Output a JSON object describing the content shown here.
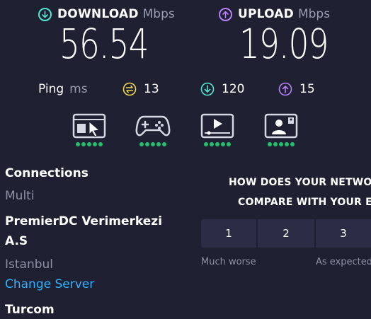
{
  "download": {
    "title": "DOWNLOAD",
    "unit": "Mbps",
    "value": "56.54",
    "icon": "arrow-down-circle",
    "color": "#4ee8d2"
  },
  "upload": {
    "title": "UPLOAD",
    "unit": "Mbps",
    "value": "19.09",
    "icon": "arrow-up-circle",
    "color": "#b682f5"
  },
  "ping": {
    "label": "Ping",
    "unit": "ms",
    "idle": {
      "value": "13",
      "icon": "idle-gauge",
      "color": "#f1d84a"
    },
    "down": {
      "value": "120",
      "icon": "arrow-down-circle",
      "color": "#4ee8d2"
    },
    "up": {
      "value": "15",
      "icon": "arrow-up-circle",
      "color": "#b682f5"
    }
  },
  "activities": [
    {
      "name": "browsing",
      "icon": "browser-window-icon",
      "rating": 5
    },
    {
      "name": "gaming",
      "icon": "gamepad-icon",
      "rating": 5
    },
    {
      "name": "streaming",
      "icon": "video-player-icon",
      "rating": 5
    },
    {
      "name": "video-chat",
      "icon": "video-call-icon",
      "rating": 5
    }
  ],
  "connections": {
    "title": "Connections",
    "mode": "Multi"
  },
  "server": {
    "name_line1": "PremierDC Verimerkezi",
    "name_line2": "A.S",
    "city": "Istanbul",
    "change_link": "Change Server"
  },
  "isp": {
    "name": "Turcom"
  },
  "compare": {
    "question_line1": "HOW DOES YOUR NETWO",
    "question_line2": "COMPARE WITH YOUR E",
    "options": [
      "1",
      "2",
      "3"
    ],
    "caption_left": "Much worse",
    "caption_right": "As expected"
  },
  "colors": {
    "background": "#1f2133",
    "good": "#25c06e",
    "link": "#2fb2ff"
  }
}
